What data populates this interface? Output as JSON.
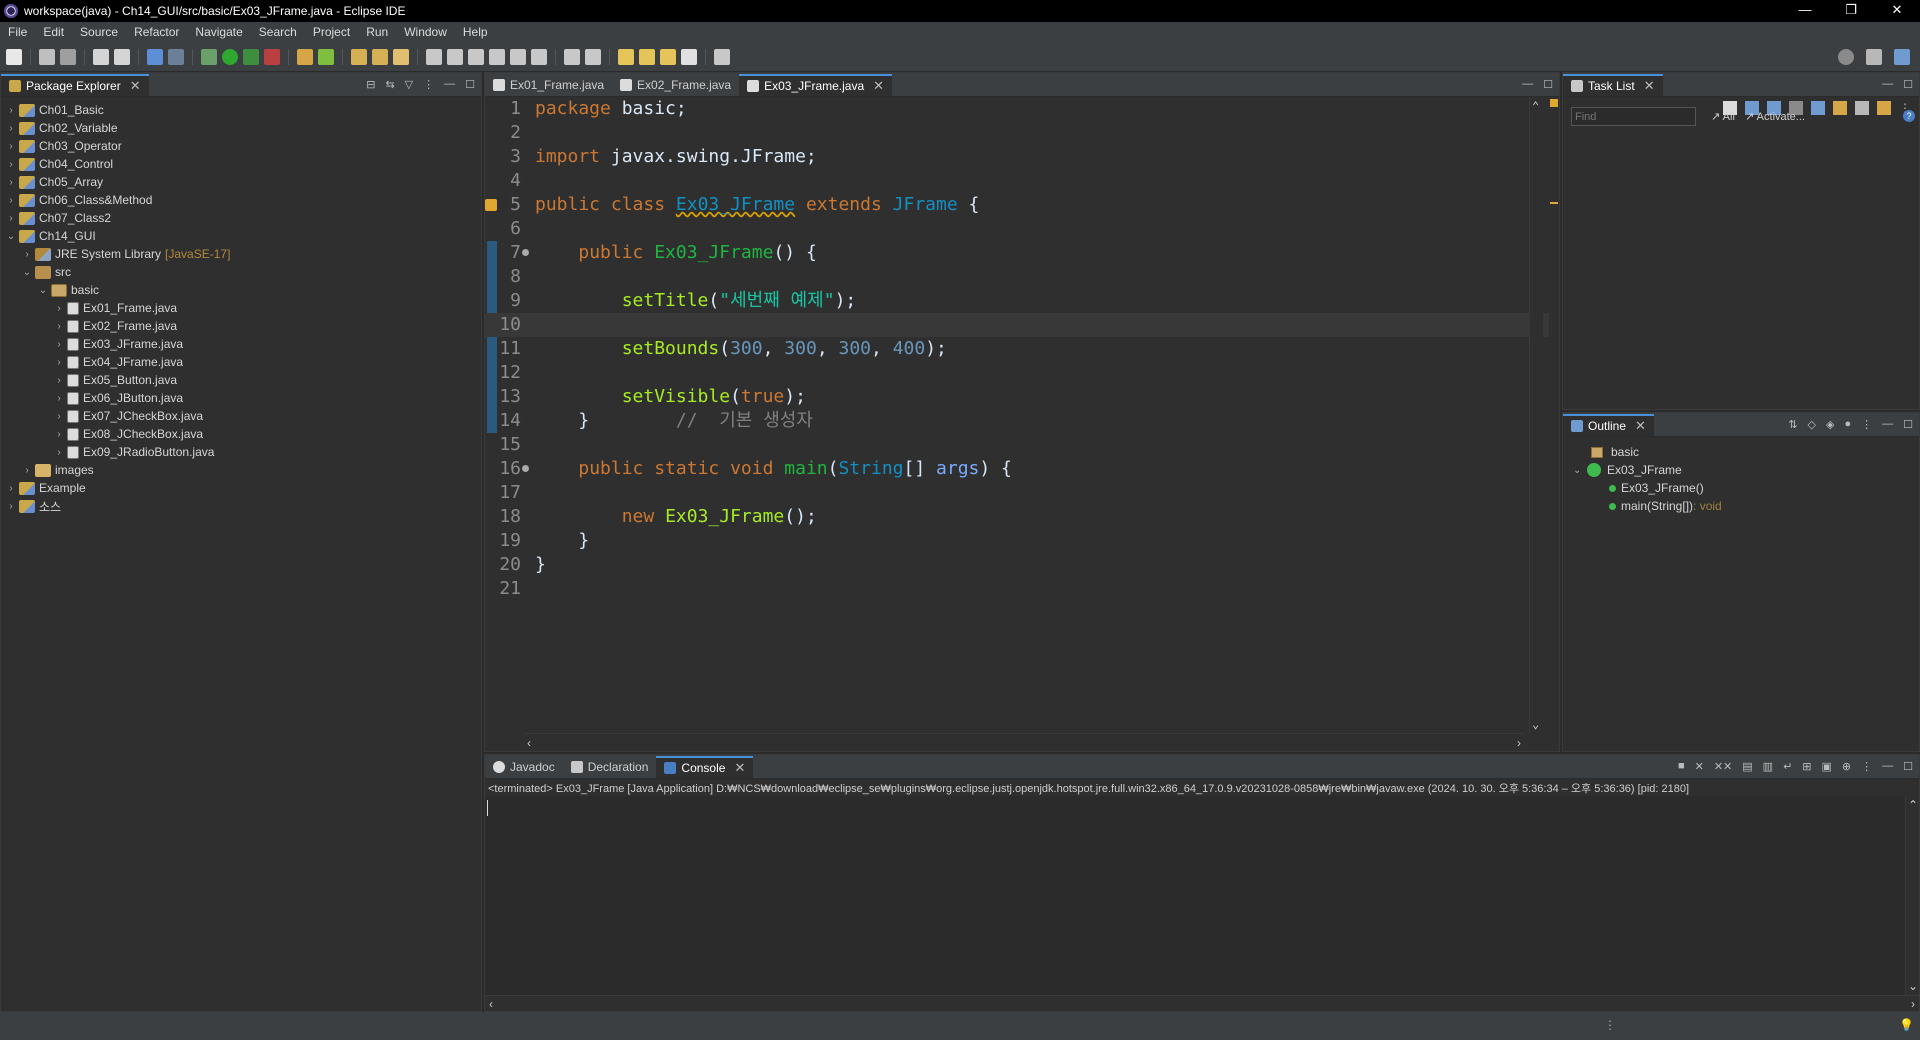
{
  "window": {
    "title": "workspace(java) - Ch14_GUI/src/basic/Ex03_JFrame.java - Eclipse IDE",
    "controls": [
      "—",
      "❐",
      "✕"
    ]
  },
  "menu": [
    "File",
    "Edit",
    "Source",
    "Refactor",
    "Navigate",
    "Search",
    "Project",
    "Run",
    "Window",
    "Help"
  ],
  "package_explorer": {
    "tab_label": "Package Explorer",
    "items": [
      {
        "label": "Ch01_Basic",
        "expanded": false,
        "icon": "project-icon"
      },
      {
        "label": "Ch02_Variable",
        "expanded": false,
        "icon": "project-icon"
      },
      {
        "label": "Ch03_Operator",
        "expanded": false,
        "icon": "project-icon"
      },
      {
        "label": "Ch04_Control",
        "expanded": false,
        "icon": "project-icon"
      },
      {
        "label": "Ch05_Array",
        "expanded": false,
        "icon": "project-icon"
      },
      {
        "label": "Ch06_Class&Method",
        "expanded": false,
        "icon": "project-icon"
      },
      {
        "label": "Ch07_Class2",
        "expanded": false,
        "icon": "project-icon"
      },
      {
        "label": "Ch14_GUI",
        "expanded": true,
        "icon": "project-icon"
      },
      {
        "label": "JRE System Library",
        "decoration": "[JavaSE-17]",
        "icon": "library-icon"
      },
      {
        "label": "src",
        "expanded": true,
        "icon": "source-folder-icon"
      },
      {
        "label": "basic",
        "expanded": true,
        "icon": "package-icon"
      },
      {
        "label": "Ex01_Frame.java",
        "icon": "java-file-icon"
      },
      {
        "label": "Ex02_Frame.java",
        "icon": "java-file-icon"
      },
      {
        "label": "Ex03_JFrame.java",
        "icon": "java-file-icon"
      },
      {
        "label": "Ex04_JFrame.java",
        "icon": "java-file-icon"
      },
      {
        "label": "Ex05_Button.java",
        "icon": "java-file-icon"
      },
      {
        "label": "Ex06_JButton.java",
        "icon": "java-file-icon"
      },
      {
        "label": "Ex07_JCheckBox.java",
        "icon": "java-file-icon"
      },
      {
        "label": "Ex08_JCheckBox.java",
        "icon": "java-file-icon"
      },
      {
        "label": "Ex09_JRadioButton.java",
        "icon": "java-file-icon"
      },
      {
        "label": "images",
        "icon": "folder-icon"
      },
      {
        "label": "Example",
        "icon": "project-icon"
      },
      {
        "label": "소스",
        "icon": "project-icon"
      }
    ]
  },
  "editor": {
    "tabs": [
      {
        "label": "Ex01_Frame.java",
        "active": false
      },
      {
        "label": "Ex02_Frame.java",
        "active": false
      },
      {
        "label": "Ex03_JFrame.java",
        "active": true
      }
    ],
    "line_numbers": [
      "1",
      "2",
      "3",
      "4",
      "5",
      "6",
      "7",
      "8",
      "9",
      "10",
      "11",
      "12",
      "13",
      "14",
      "15",
      "16",
      "17",
      "18",
      "19",
      "20",
      "21"
    ],
    "code": {
      "l1_kw": "package",
      "l1_rest": " basic;",
      "l3_kw": "import",
      "l3_rest": " javax.swing.JFrame;",
      "l5_kw1": "public class ",
      "l5_cls": "Ex03_JFrame",
      "l5_kw2": " extends ",
      "l5_cls2": "JFrame",
      "l5_rest": " {",
      "l7_indent": "    ",
      "l7_kw": "public ",
      "l7_mth": "Ex03_JFrame",
      "l7_rest": "() {",
      "l9_indent": "        ",
      "l9_call": "setTitle",
      "l9_p1": "(",
      "l9_str": "\"세번째 예제\"",
      "l9_p2": ");",
      "l11_indent": "        ",
      "l11_call": "setBounds",
      "l11_p1": "(",
      "l11_n1": "300",
      "l11_c1": ", ",
      "l11_n2": "300",
      "l11_c2": ", ",
      "l11_n3": "300",
      "l11_c3": ", ",
      "l11_n4": "400",
      "l11_p2": ");",
      "l13_indent": "        ",
      "l13_call": "setVisible",
      "l13_p1": "(",
      "l13_kw": "true",
      "l13_p2": ");",
      "l14_indent": "    ",
      "l14_brace": "}",
      "l14_cmt": "        //  기본 생성자",
      "l16_indent": "    ",
      "l16_kw": "public static void ",
      "l16_mth": "main",
      "l16_p1": "(",
      "l16_cls": "String",
      "l16_p2": "[] ",
      "l16_param": "args",
      "l16_p3": ") {",
      "l18_indent": "        ",
      "l18_kw": "new ",
      "l18_call": "Ex03_JFrame",
      "l18_rest": "();",
      "l19_indent": "    ",
      "l19_brace": "}",
      "l20_brace": "}"
    }
  },
  "task_list": {
    "tab_label": "Task List",
    "find_placeholder": "Find",
    "all_label": "All",
    "activate_label": "Activate..."
  },
  "outline": {
    "tab_label": "Outline",
    "package": "basic",
    "class": "Ex03_JFrame",
    "constructor": "Ex03_JFrame()",
    "method": "main(String[])",
    "method_type": " : void"
  },
  "bottom_panel": {
    "tabs": [
      {
        "label": "Javadoc",
        "active": false
      },
      {
        "label": "Declaration",
        "active": false
      },
      {
        "label": "Console",
        "active": true
      }
    ],
    "console_info": "<terminated> Ex03_JFrame [Java Application] D:₩NCS₩download₩eclipse_se₩plugins₩org.eclipse.justj.openjdk.hotspot.jre.full.win32.x86_64_17.0.9.v20231028-0858₩jre₩bin₩javaw.exe  (2024. 10. 30. 오후 5:36:34 – 오후 5:36:36) [pid: 2180]"
  },
  "colors": {
    "keyword": "#cc7832",
    "class": "#1290c3",
    "method": "#1eb540",
    "string": "#17c6a3",
    "number": "#6897bb",
    "accent": "#4a90d9"
  }
}
